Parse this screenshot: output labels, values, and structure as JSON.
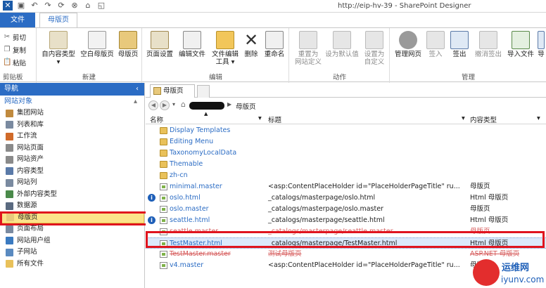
{
  "window": {
    "title": "http://eip-hv-39 - SharePoint Designer"
  },
  "ribbon_tabs": {
    "file": "文件",
    "master_pages": "母版页"
  },
  "ribbon": {
    "clipboard": {
      "cut": "剪切",
      "copy": "复制",
      "paste": "粘贴",
      "label": "剪贴板"
    },
    "new": {
      "from_content_type": "自内容类型",
      "blank_master": "空白母版页",
      "master": "母版页",
      "label": "新建"
    },
    "edit": {
      "page_settings": "页面设置",
      "edit_file": "编辑文件",
      "edit_tools_1": "文件编辑",
      "edit_tools_2": "工具",
      "delete": "删除",
      "rename": "重命名",
      "label": "编辑"
    },
    "actions": {
      "reset_1": "重置为",
      "reset_2": "网站定义",
      "set_default": "设为默认值",
      "set_custom_1": "设置为",
      "set_custom_2": "自定义",
      "label": "动作"
    },
    "manage": {
      "admin_page": "管理网页",
      "check_in": "签入",
      "check_out": "签出",
      "undo_checkout": "撤消签出",
      "import_file": "导入文件",
      "export": "导",
      "label": "管理"
    }
  },
  "nav": {
    "header": "导航",
    "section": "网站对象",
    "items": [
      {
        "label": "集团网站",
        "color": "#c08a3e"
      },
      {
        "label": "列表和库",
        "color": "#7a8aa0"
      },
      {
        "label": "工作流",
        "color": "#d06a2a"
      },
      {
        "label": "网站页面",
        "color": "#8a8a8a"
      },
      {
        "label": "网站资产",
        "color": "#8a8a8a"
      },
      {
        "label": "内容类型",
        "color": "#5a7aa8"
      },
      {
        "label": "网站列",
        "color": "#7a8aa0"
      },
      {
        "label": "外部内容类型",
        "color": "#4a8a4a"
      },
      {
        "label": "数据源",
        "color": "#5a6a80"
      },
      {
        "label": "母版页",
        "color": "#e8c97c"
      },
      {
        "label": "页面布局",
        "color": "#7a8aa0"
      },
      {
        "label": "网站用户组",
        "color": "#3a7ac0"
      },
      {
        "label": "子网站",
        "color": "#5a8ac0"
      },
      {
        "label": "所有文件",
        "color": "#e9c15a"
      }
    ]
  },
  "doc_tab": {
    "label": "母版页"
  },
  "breadcrumb": {
    "current": "母版页"
  },
  "columns": {
    "name": "名称",
    "title": "标题",
    "content_type": "内容类型"
  },
  "files": [
    {
      "name": "Display Templates",
      "title": "",
      "type": "",
      "kind": "folder"
    },
    {
      "name": "Editing Menu",
      "title": "",
      "type": "",
      "kind": "folder"
    },
    {
      "name": "TaxonomyLocalData",
      "title": "",
      "type": "",
      "kind": "folder"
    },
    {
      "name": "Themable",
      "title": "",
      "type": "",
      "kind": "folder"
    },
    {
      "name": "zh-cn",
      "title": "",
      "type": "",
      "kind": "folder"
    },
    {
      "name": "minimal.master",
      "title": "<asp:ContentPlaceHolder id=\"PlaceHolderPageTitle\" ru...",
      "type": "母版页",
      "kind": "page"
    },
    {
      "name": "oslo.html",
      "title": "_catalogs/masterpage/oslo.html",
      "type": "Html 母版页",
      "kind": "page",
      "info": true
    },
    {
      "name": "oslo.master",
      "title": "_catalogs/masterpage/oslo.master",
      "type": "母版页",
      "kind": "page"
    },
    {
      "name": "seattle.html",
      "title": "_catalogs/masterpage/seattle.html",
      "type": "Html 母版页",
      "kind": "page",
      "info": true
    },
    {
      "name": "seattle.master",
      "title": "_catalogs/masterpage/seattle.master",
      "type": "母版页",
      "kind": "page",
      "strike": true
    },
    {
      "name": "TestMaster.html",
      "title": "_catalogs/masterpage/TestMaster.html",
      "type": "Html 母版页",
      "kind": "page",
      "selected": true
    },
    {
      "name": "TestMaster.master",
      "title": "测试母版页",
      "type": "ASP.NET 母版页",
      "kind": "page",
      "strike": true
    },
    {
      "name": "v4.master",
      "title": "<asp:ContentPlaceHolder id=\"PlaceHolderPageTitle\" ru...",
      "type": "母版页",
      "kind": "page"
    }
  ],
  "watermark": {
    "brand": "运维网",
    "url": "iyunv.com"
  }
}
